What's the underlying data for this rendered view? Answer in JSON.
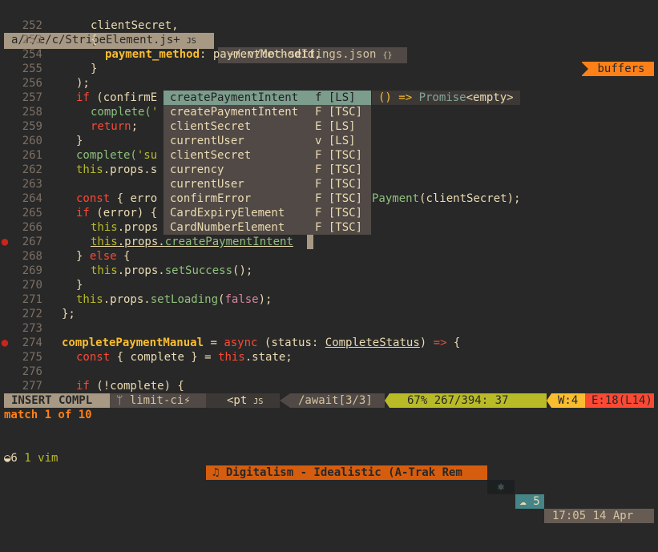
{
  "tabs": {
    "active": {
      "label": "a/r/e/c/StripeElement.js+",
      "icon": "JS"
    },
    "inactive": {
      "label": "~/.v/coc-settings.json",
      "icon": "{}"
    },
    "buffers_label": "buffers"
  },
  "lines": {
    "l252": {
      "num": "252"
    },
    "l253": {
      "num": "253"
    },
    "l254": {
      "num": "254"
    },
    "l255": {
      "num": "255"
    },
    "l256": {
      "num": "256"
    },
    "l257": {
      "num": "257"
    },
    "l258": {
      "num": "258"
    },
    "l259": {
      "num": "259"
    },
    "l260": {
      "num": "260"
    },
    "l261": {
      "num": "261"
    },
    "l262": {
      "num": "262"
    },
    "l263": {
      "num": "263"
    },
    "l264": {
      "num": "264"
    },
    "l265": {
      "num": "265"
    },
    "l266": {
      "num": "266"
    },
    "l267": {
      "num": "267"
    },
    "l268": {
      "num": "268"
    },
    "l269": {
      "num": "269"
    },
    "l270": {
      "num": "270"
    },
    "l271": {
      "num": "271"
    },
    "l272": {
      "num": "272"
    },
    "l273": {
      "num": "273"
    },
    "l274": {
      "num": "274"
    },
    "l275": {
      "num": "275"
    },
    "l276": {
      "num": "276"
    },
    "l277": {
      "num": "277"
    }
  },
  "code": {
    "t252": "clientSecret,",
    "t253": "{",
    "t254a": "payment_method",
    "t254b": ": paymentMethodId,",
    "t255": "}",
    "t256": ");",
    "t257a": "if",
    "t257b": " (confirmE",
    "t258a": "complete(",
    "t258b": "'",
    "t259a": "return",
    "t259b": ";",
    "t260": "}",
    "t261a": "complete(",
    "t261b": "'su",
    "t262a": "this",
    "t262b": ".props.s",
    "t264a": "const",
    "t264b": " { erro",
    "t264c": "Payment",
    "t264d": "(clientSecret);",
    "t265a": "if",
    "t265b": " (error) {",
    "t266a": "this",
    "t266b": ".props",
    "t267a": "this",
    "t267b": ".props.",
    "t267c": "createPaymentIntent",
    "t268a": "} ",
    "t268b": "else",
    "t268c": " {",
    "t269a": "this",
    "t269b": ".props.",
    "t269c": "setSuccess",
    "t269d": "();",
    "t270": "}",
    "t271a": "this",
    "t271b": ".props.",
    "t271c": "setLoading",
    "t271d": "(",
    "t271e": "false",
    "t271f": ");",
    "t272": "};",
    "t274a": "completePaymentManual",
    "t274b": " = ",
    "t274c": "async",
    "t274d": " (status: ",
    "t274e": "CompleteStatus",
    "t274f": ") ",
    "t274g": "=>",
    "t274h": " {",
    "t275a": "const",
    "t275b": " { complete } = ",
    "t275c": "this",
    "t275d": ".state;",
    "t277a": "if",
    "t277b": " (!complete) {"
  },
  "completion": {
    "items": [
      {
        "name": "createPaymentIntent",
        "kind": "f [LS]"
      },
      {
        "name": "createPaymentIntent",
        "kind": "F [TSC]"
      },
      {
        "name": "clientSecret",
        "kind": "E [LS]"
      },
      {
        "name": "currentUser",
        "kind": "v [LS]"
      },
      {
        "name": "clientSecret",
        "kind": "F [TSC]"
      },
      {
        "name": "currency",
        "kind": "F [TSC]"
      },
      {
        "name": "currentUser",
        "kind": "F [TSC]"
      },
      {
        "name": "confirmError",
        "kind": "F [TSC]"
      },
      {
        "name": "CardExpiryElement",
        "kind": "F [TSC]"
      },
      {
        "name": "CardNumberElement",
        "kind": "F [TSC]"
      }
    ],
    "detail": {
      "a": "()",
      "b": " => ",
      "c": "Promise",
      "d": "<empty>"
    }
  },
  "statusline": {
    "mode": "INSERT COMPL",
    "branch": "ᛘ limit-ci⚡",
    "file": "<pt",
    "file_icon": "JS",
    "func": "/await[3/3]",
    "position": "67% 267/394: 37",
    "warnings": "W:4",
    "errors": "E:18(L14)"
  },
  "cmdline": {
    "text": "match 1 of 10"
  },
  "tmux": {
    "session": "◒6",
    "window": "1 vim",
    "music": "♫ Digitalism - Idealistic (A-Trak Rem",
    "icon1": "⚛",
    "icon2": "☁ 5",
    "clock": "17:05 14 Apr"
  },
  "colors": {
    "background": "#282828",
    "accent_orange": "#fe8019",
    "statusline_green": "#b8bb26",
    "error_red": "#fb4934",
    "warning_yellow": "#fabd2f"
  }
}
